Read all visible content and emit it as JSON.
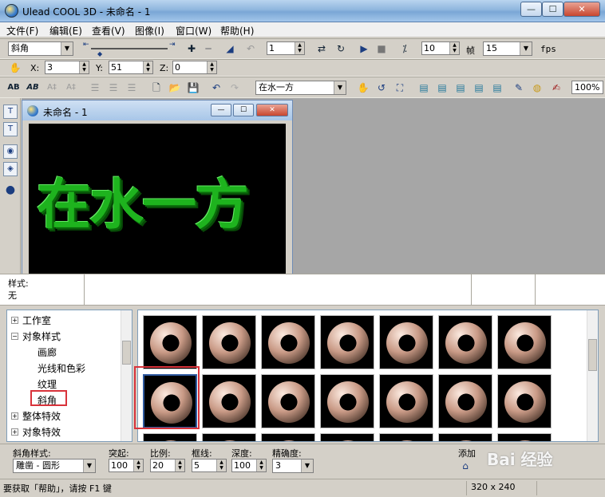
{
  "window": {
    "title": "Ulead COOL 3D - 未命名 - 1",
    "min": "—",
    "max": "☐",
    "close": "✕"
  },
  "menu": [
    "文件(F)",
    "编辑(E)",
    "查看(V)",
    "图像(I)",
    "窗口(W)",
    "帮助(H)"
  ],
  "toolbar1": {
    "object_select": "斜角",
    "frame_value": "1",
    "total_frames": "10",
    "frame_label": "帧",
    "fps_value": "15",
    "fps_label": "fps"
  },
  "toolbar2": {
    "x_label": "X:",
    "x_value": "3",
    "y_label": "Y:",
    "y_value": "51",
    "z_label": "Z:",
    "z_value": "0"
  },
  "toolbar3": {
    "text_select": "在水一方",
    "zoom": "100%"
  },
  "child_window": {
    "title": "未命名 - 1",
    "canvas_text": "在水一方"
  },
  "style_strip": {
    "label": "样式:",
    "value": "无"
  },
  "tree": {
    "items": [
      "工作室",
      "对象样式",
      "画廊",
      "光线和色彩",
      "纹理",
      "斜角",
      "整体特效",
      "对象特效"
    ]
  },
  "properties": {
    "bevel_style_label": "斜角样式:",
    "bevel_style_value": "雕凿 - 圆形",
    "protrude_label": "突起:",
    "protrude_value": "100",
    "ratio_label": "比例:",
    "ratio_value": "20",
    "border_label": "框线:",
    "border_value": "5",
    "depth_label": "深度:",
    "depth_value": "100",
    "precision_label": "精确度:",
    "precision_value": "3",
    "add_label": "添加"
  },
  "status": {
    "help": "要获取「帮助」，请按 F1 键",
    "size": "320 x 240"
  },
  "watermark": "Bai 经验"
}
